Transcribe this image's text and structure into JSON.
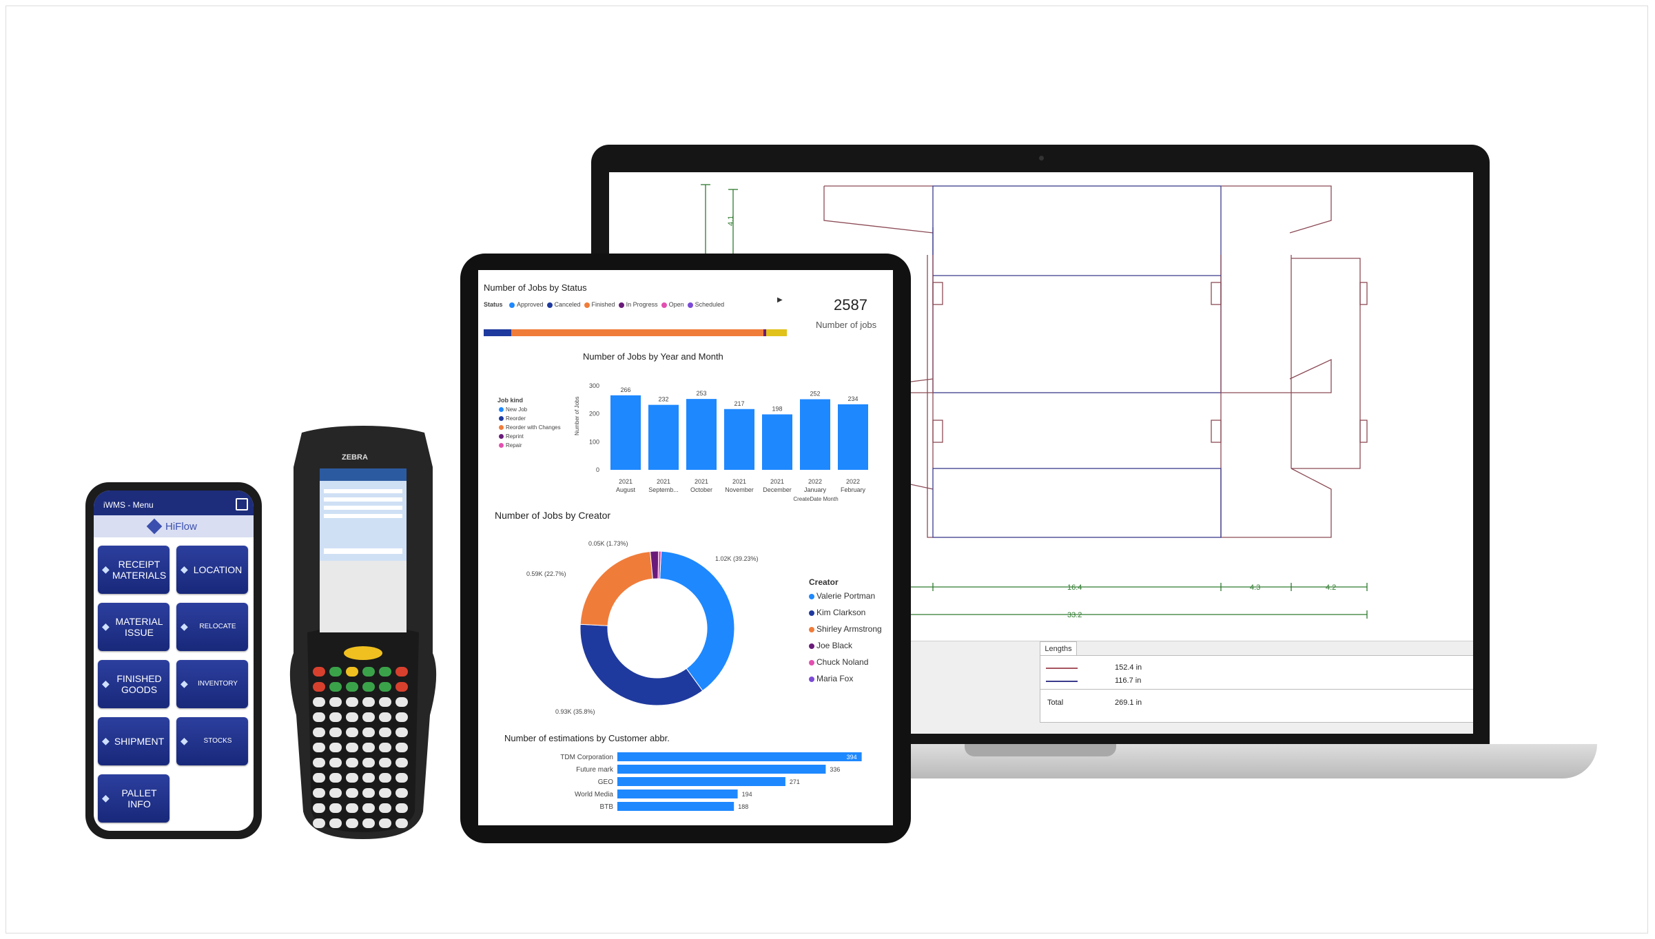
{
  "laptop": {
    "dims": {
      "d1": "16.4",
      "d2": "4.3",
      "d3": "4.2",
      "d4": "33.2",
      "d5": "4.1"
    },
    "lengths_tab": "Lengths",
    "rows": [
      {
        "value": "152.4 in"
      },
      {
        "value": "116.7 in"
      }
    ],
    "total_label": "Total",
    "total_value": "269.1 in"
  },
  "tablet": {
    "jobs_status_title": "Number of Jobs by Status",
    "status_label": "Status",
    "status_items": [
      {
        "label": "Approved",
        "color": "#1e88ff"
      },
      {
        "label": "Canceled",
        "color": "#1f3a9e"
      },
      {
        "label": "Finished",
        "color": "#f07c3a"
      },
      {
        "label": "In Progress",
        "color": "#6a1b7a"
      },
      {
        "label": "Open",
        "color": "#e34fb0"
      },
      {
        "label": "Scheduled",
        "color": "#7b4bd6"
      }
    ],
    "kpi_value": "2587",
    "kpi_label": "Number of jobs",
    "year_month_title": "Number of Jobs by Year and Month",
    "job_kind_label": "Job kind",
    "job_kinds": [
      {
        "label": "New Job",
        "color": "#1e88ff"
      },
      {
        "label": "Reorder",
        "color": "#1f3a9e"
      },
      {
        "label": "Reorder with Changes",
        "color": "#f07c3a"
      },
      {
        "label": "Reprint",
        "color": "#6a1b7a"
      },
      {
        "label": "Repair",
        "color": "#e34fb0"
      }
    ],
    "creator_title": "Number of Jobs by Creator",
    "creator_legend_title": "Creator",
    "creators": [
      {
        "label": "Valerie Portman",
        "color": "#1e88ff"
      },
      {
        "label": "Kim Clarkson",
        "color": "#1f3a9e"
      },
      {
        "label": "Shirley Armstrong",
        "color": "#f07c3a"
      },
      {
        "label": "Joe Black",
        "color": "#6a1b7a"
      },
      {
        "label": "Chuck Noland",
        "color": "#e34fb0"
      },
      {
        "label": "Maria Fox",
        "color": "#7b4bd6"
      }
    ],
    "donut_labels": {
      "a": "0.05K (1.73%)",
      "b": "0.59K (22.7%)",
      "c": "1.02K (39.23%)",
      "d": "0.93K (35.8%)"
    },
    "estimations_title": "Number of estimations by Customer abbr."
  },
  "chart_data": [
    {
      "type": "bar",
      "title": "Number of Jobs by Year and Month",
      "categories": [
        "2021 August",
        "2021 Septemb...",
        "2021 October",
        "2021 November",
        "2021 December",
        "2022 January",
        "2022 February"
      ],
      "values": [
        266,
        232,
        253,
        217,
        198,
        252,
        234
      ],
      "ylabel": "Number of Jobs",
      "xlabel": "CreateDate Month",
      "ylim": [
        0,
        300
      ],
      "yticks": [
        0,
        100,
        200,
        300
      ]
    },
    {
      "type": "pie",
      "title": "Number of Jobs by Creator",
      "categories": [
        "Valerie Portman",
        "Kim Clarkson",
        "Shirley Armstrong",
        "Joe Black",
        "Chuck Noland"
      ],
      "values": [
        39.23,
        35.8,
        22.7,
        1.73,
        0.54
      ]
    },
    {
      "type": "bar",
      "title": "Number of estimations by Customer abbr.",
      "categories": [
        "TDM Corporation",
        "Future mark",
        "GEO",
        "World Media",
        "BTB"
      ],
      "values": [
        394,
        336,
        271,
        194,
        188
      ]
    }
  ],
  "zebra": {
    "brand": "ZEBRA"
  },
  "phone": {
    "header_title": "iWMS - Menu",
    "brand": "HiFlow",
    "tiles": [
      {
        "label": "RECEIPT MATERIALS"
      },
      {
        "label": "LOCATION"
      },
      {
        "label": "MATERIAL ISSUE"
      },
      {
        "label": "RELOCATE"
      },
      {
        "label": "FINISHED GOODS"
      },
      {
        "label": "INVENTORY"
      },
      {
        "label": "SHIPMENT"
      },
      {
        "label": "STOCKS"
      },
      {
        "label": "PALLET INFO"
      }
    ]
  }
}
